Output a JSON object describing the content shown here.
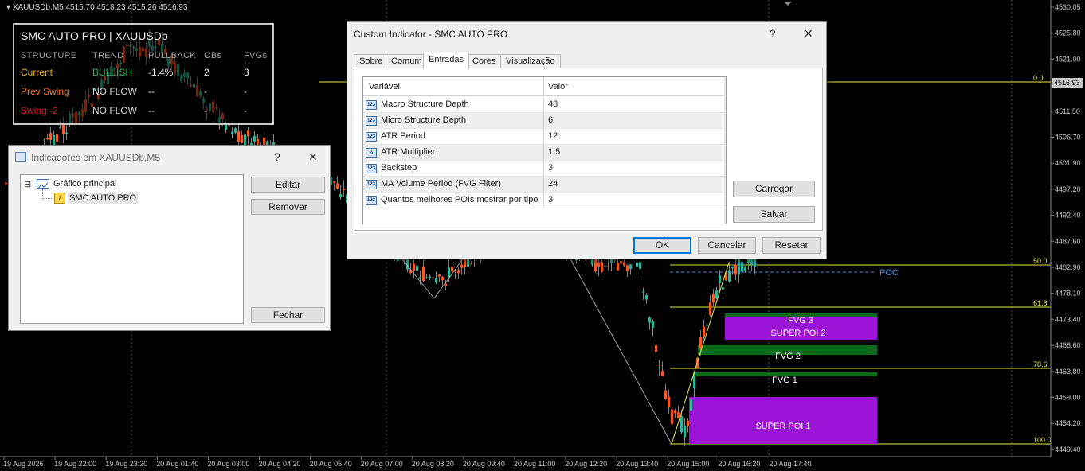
{
  "chart": {
    "header": "XAUUSDb,M5  4515.70 4518.23 4515.26 4516.93",
    "price_ticks": [
      "4530.05",
      "4525.80",
      "4521.00",
      "4516.93",
      "4511.50",
      "4506.70",
      "4501.90",
      "4497.20",
      "4492.40",
      "4487.60",
      "4482.90",
      "4478.10",
      "4473.40",
      "4468.60",
      "4463.80",
      "4459.00",
      "4454.20",
      "4449.40"
    ],
    "current_price": "4516.93",
    "time_ticks": [
      "19 Aug 2026",
      "19 Aug 22:00",
      "19 Aug 23:20",
      "20 Aug 01:40",
      "20 Aug 03:00",
      "20 Aug 04:20",
      "20 Aug 05:40",
      "20 Aug 07:00",
      "20 Aug 08:20",
      "20 Aug 09:40",
      "20 Aug 11:00",
      "20 Aug 12:20",
      "20 Aug 13:40",
      "20 Aug 15:00",
      "20 Aug 16:20",
      "20 Aug 17:40"
    ],
    "fib_levels": [
      "0.0",
      "50.0",
      "61.8",
      "78.6",
      "100.0"
    ],
    "poc_label": "POC",
    "zones": {
      "fvg3": "FVG 3",
      "super_poi_2": "SUPER POI 2",
      "fvg2": "FVG 2",
      "fvg1": "FVG 1",
      "super_poi_1": "SUPER POI 1"
    },
    "colors": {
      "bull": "#2fb59a",
      "bear": "#f25a28",
      "fib": "#e7e74a",
      "poi": "#9b14d8",
      "fvg": "#0d6b1b",
      "poc": "#4a8fe2"
    }
  },
  "smc_panel": {
    "title": "SMC AUTO PRO | XAUUSDb",
    "headers": [
      "STRUCTURE",
      "TREND",
      "PULLBACK",
      "OBs",
      "FVGs"
    ],
    "rows": [
      {
        "name": "Current",
        "trend": "BULLISH",
        "pullback": "-1.4%",
        "obs": "2",
        "fvgs": "3",
        "name_color": "#f0b400",
        "trend_color": "#2fbf4f"
      },
      {
        "name": "Prev Swing",
        "trend": "NO FLOW",
        "pullback": "--",
        "obs": "-",
        "fvgs": "-",
        "name_color": "#f07a1a",
        "trend_color": "#d8d8d8"
      },
      {
        "name": "Swing -2",
        "trend": "NO FLOW",
        "pullback": "--",
        "obs": "-",
        "fvgs": "-",
        "name_color": "#e0202a",
        "trend_color": "#d8d8d8"
      }
    ]
  },
  "indicators_dialog": {
    "title": "Indicadores em XAUUSDb,M5",
    "help": "?",
    "close": "✕",
    "tree_root": "Gráfico principal",
    "tree_child": "SMC AUTO PRO",
    "buttons": {
      "edit": "Editar",
      "remove": "Remover",
      "close": "Fechar"
    }
  },
  "custom_dialog": {
    "title": "Custom Indicator - SMC AUTO PRO",
    "help": "?",
    "close": "✕",
    "tabs": [
      "Sobre",
      "Comum",
      "Entradas",
      "Cores",
      "Visualização"
    ],
    "active_tab": "Entradas",
    "col_variable": "Variável",
    "col_value": "Valor",
    "params": [
      {
        "icon": "123",
        "name": "Macro Structure Depth",
        "value": "48"
      },
      {
        "icon": "123",
        "name": "Micro Structure Depth",
        "value": "6"
      },
      {
        "icon": "123",
        "name": "ATR Period",
        "value": "12"
      },
      {
        "icon": "½",
        "name": "ATR Multiplier",
        "value": "1.5"
      },
      {
        "icon": "123",
        "name": "Backstep",
        "value": "3"
      },
      {
        "icon": "123",
        "name": "MA Volume Period (FVG Filter)",
        "value": "24"
      },
      {
        "icon": "123",
        "name": "Quantos melhores POIs mostrar por tipo",
        "value": "3"
      }
    ],
    "buttons": {
      "load": "Carregar",
      "save": "Salvar",
      "ok": "OK",
      "cancel": "Cancelar",
      "reset": "Resetar"
    }
  }
}
